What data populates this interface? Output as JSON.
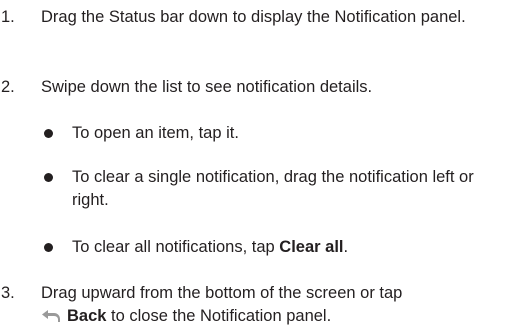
{
  "steps": [
    {
      "number": "1.",
      "text": "Drag the Status bar down to display the Notification panel."
    },
    {
      "number": "2.",
      "text": "Swipe down the list to see notification details."
    },
    {
      "number": "3.",
      "text_before": "Drag upward from the bottom of the screen or tap",
      "bold": "Back",
      "text_after": " to close the Notification panel.",
      "icon": "back-arrow-icon"
    }
  ],
  "bullets": [
    {
      "text": "To open an item, tap it."
    },
    {
      "text": "To clear a single notification, drag the notification left or right."
    },
    {
      "text_before": "To clear all notifications, tap ",
      "bold": "Clear all",
      "text_after": "."
    }
  ]
}
